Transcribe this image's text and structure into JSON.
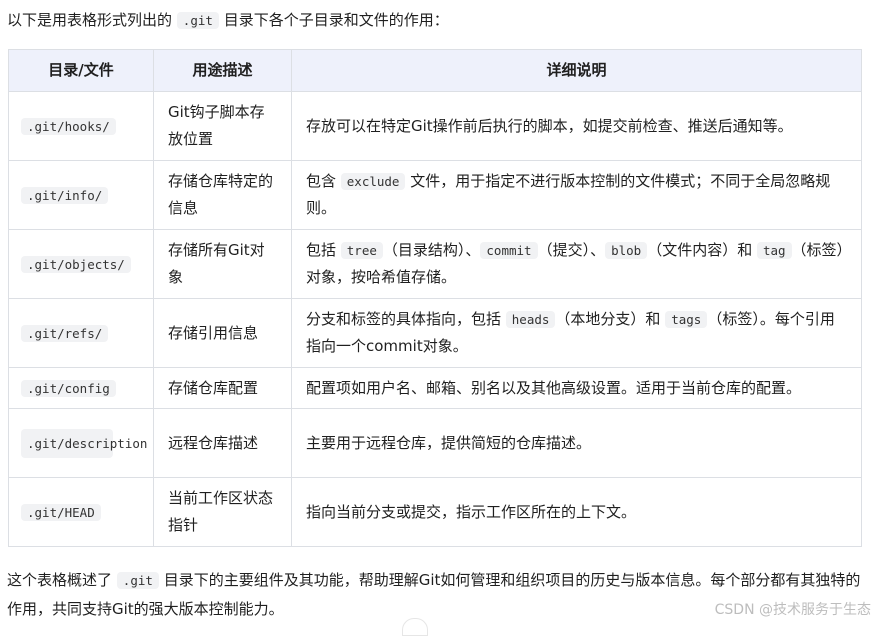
{
  "intro": {
    "before": "以下是用表格形式列出的",
    "code": ".git",
    "after": "目录下各个子目录和文件的作用："
  },
  "table": {
    "headers": [
      "目录/文件",
      "用途描述",
      "详细说明"
    ],
    "rows": [
      {
        "path": ".git/hooks/",
        "purpose": "Git钩子脚本存放位置",
        "detail": [
          {
            "t": "存放可以在特定Git操作前后执行的脚本，如提交前检查、推送后通知等。"
          }
        ]
      },
      {
        "path": ".git/info/",
        "purpose": "存储仓库特定的信息",
        "detail": [
          {
            "t": "包含 "
          },
          {
            "c": "exclude"
          },
          {
            "t": " 文件，用于指定不进行版本控制的文件模式；不同于全局忽略规则。"
          }
        ]
      },
      {
        "path": ".git/objects/",
        "purpose": "存储所有Git对象",
        "detail": [
          {
            "t": "包括 "
          },
          {
            "c": "tree"
          },
          {
            "t": "（目录结构）、"
          },
          {
            "c": "commit"
          },
          {
            "t": "（提交）、"
          },
          {
            "c": "blob"
          },
          {
            "t": "（文件内容）和 "
          },
          {
            "c": "tag"
          },
          {
            "t": "（标签）对象，按哈希值存储。"
          }
        ]
      },
      {
        "path": ".git/refs/",
        "purpose": "存储引用信息",
        "detail": [
          {
            "t": "分支和标签的具体指向，包括 "
          },
          {
            "c": "heads"
          },
          {
            "t": "（本地分支）和 "
          },
          {
            "c": "tags"
          },
          {
            "t": "（标签）。每个引用指向一个commit对象。"
          }
        ]
      },
      {
        "path": ".git/config",
        "purpose": "存储仓库配置",
        "detail": [
          {
            "t": "配置项如用户名、邮箱、别名以及其他高级设置。适用于当前仓库的配置。"
          }
        ]
      },
      {
        "path": ".git/description",
        "purpose": "远程仓库描述",
        "detail": [
          {
            "t": "主要用于远程仓库，提供简短的仓库描述。"
          }
        ]
      },
      {
        "path": ".git/HEAD",
        "purpose": "当前工作区状态指针",
        "detail": [
          {
            "t": "指向当前分支或提交，指示工作区所在的上下文。"
          }
        ]
      }
    ]
  },
  "outro": {
    "before": "这个表格概述了",
    "code": ".git",
    "after": "目录下的主要组件及其功能，帮助理解Git如何管理和组织项目的历史与版本信息。每个部分都有其独特的作用，共同支持Git的强大版本控制能力。"
  },
  "watermark": "CSDN @技术服务于生态"
}
